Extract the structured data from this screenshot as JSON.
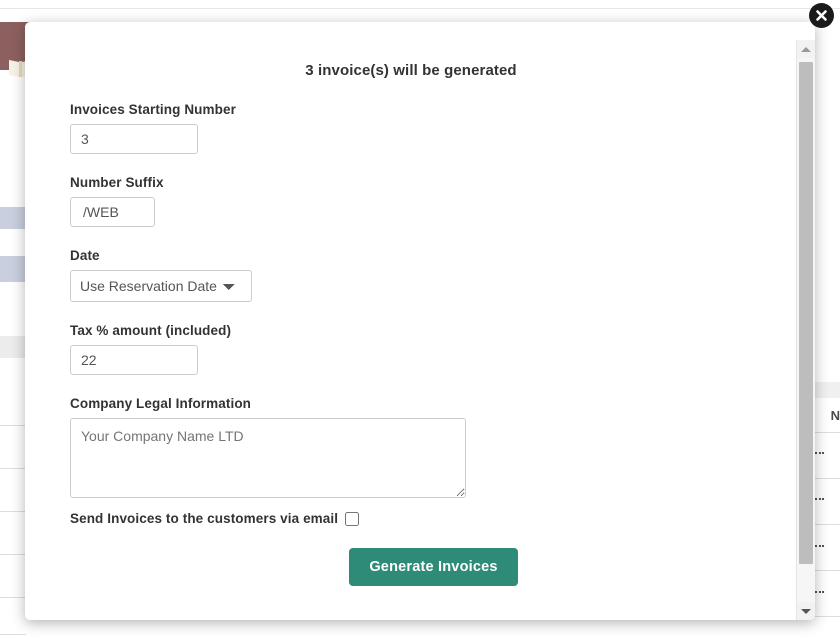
{
  "background": {
    "brand_icon": "book-icon",
    "column_header": "N"
  },
  "modal": {
    "title": "3 invoice(s) will be generated",
    "close_icon": "close-circle-icon",
    "fields": {
      "starting_number": {
        "label": "Invoices Starting Number",
        "value": "3",
        "placeholder": ""
      },
      "suffix": {
        "label": "Number Suffix",
        "value": "/WEB",
        "placeholder": ""
      },
      "date": {
        "label": "Date",
        "selected": "Use Reservation Date",
        "options": [
          "Use Reservation Date"
        ],
        "chevron_icon": "chevron-down-icon"
      },
      "tax": {
        "label": "Tax % amount (included)",
        "value": "22",
        "placeholder": ""
      },
      "legal_info": {
        "label": "Company Legal Information",
        "value": "",
        "placeholder": "Your Company Name LTD"
      },
      "send_email": {
        "label": "Send Invoices to the customers via email",
        "checked": false
      }
    },
    "submit_label": "Generate Invoices",
    "scrollbar": {
      "up_icon": "arrow-up-icon",
      "down_icon": "arrow-down-icon"
    }
  },
  "colors": {
    "accent": "#2e8b78",
    "brand_bar": "#8d6060",
    "row_highlight": "#c9cfde"
  }
}
